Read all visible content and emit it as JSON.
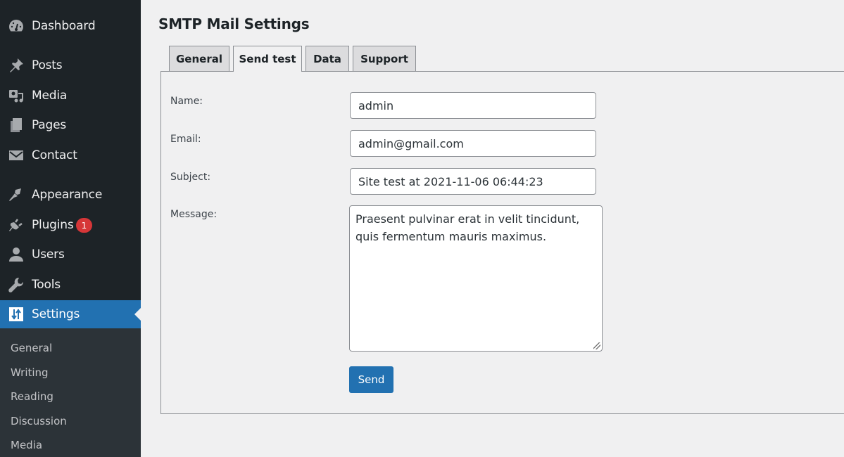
{
  "sidebar": {
    "items": [
      {
        "label": "Dashboard",
        "icon": "dashboard-icon"
      },
      {
        "label": "Posts",
        "icon": "pin-icon"
      },
      {
        "label": "Media",
        "icon": "media-icon"
      },
      {
        "label": "Pages",
        "icon": "pages-icon"
      },
      {
        "label": "Contact",
        "icon": "envelope-icon"
      },
      {
        "label": "Appearance",
        "icon": "paintbrush-icon"
      },
      {
        "label": "Plugins",
        "icon": "plugin-icon",
        "badge": "1"
      },
      {
        "label": "Users",
        "icon": "user-icon"
      },
      {
        "label": "Tools",
        "icon": "wrench-icon"
      },
      {
        "label": "Settings",
        "icon": "settings-icon",
        "active": true
      }
    ],
    "submenu": [
      "General",
      "Writing",
      "Reading",
      "Discussion",
      "Media"
    ]
  },
  "page": {
    "title": "SMTP Mail Settings",
    "tabs": [
      {
        "label": "General"
      },
      {
        "label": "Send test",
        "active": true
      },
      {
        "label": "Data"
      },
      {
        "label": "Support"
      }
    ],
    "form": {
      "name_label": "Name:",
      "name_value": "admin",
      "email_label": "Email:",
      "email_value": "admin@gmail.com",
      "subject_label": "Subject:",
      "subject_value": "Site test at 2021-11-06 06:44:23",
      "message_label": "Message:",
      "message_value": "Praesent pulvinar erat in velit tincidunt, quis fermentum mauris maximus.",
      "send_label": "Send"
    }
  },
  "colors": {
    "sidebar_bg": "#1d2327",
    "submenu_bg": "#2c3338",
    "accent": "#2271b1",
    "badge": "#d63638",
    "page_bg": "#f0f0f1"
  }
}
